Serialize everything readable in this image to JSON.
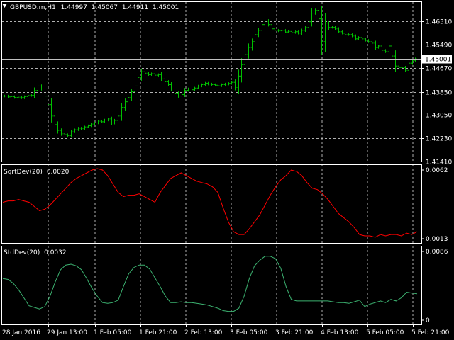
{
  "chart_data": [
    {
      "type": "ohlc",
      "header": {
        "symbol": "GBPUSD.m,H1",
        "open": "1.44997",
        "high": "1.45067",
        "low": "1.44911",
        "close": "1.45001"
      },
      "ylim": [
        1.4141,
        1.4701
      ],
      "y_ticks": [
        "1.46310",
        "1.45490",
        "1.44670",
        "1.43850",
        "1.43050",
        "1.42230",
        "1.41410"
      ],
      "current_price": "1.45001",
      "colors": {
        "bars": "#00c000",
        "price_line": "#c0c0c0",
        "current_label_bg": "#ffffff"
      },
      "closes": [
        1.437,
        1.4367,
        1.4368,
        1.4365,
        1.4366,
        1.4364,
        1.4368,
        1.4372,
        1.4372,
        1.439,
        1.4405,
        1.4395,
        1.437,
        1.434,
        1.43,
        1.427,
        1.425,
        1.4238,
        1.4235,
        1.4232,
        1.4245,
        1.4252,
        1.4258,
        1.4256,
        1.4262,
        1.4266,
        1.4272,
        1.4276,
        1.4282,
        1.428,
        1.4286,
        1.429,
        1.4276,
        1.4285,
        1.43,
        1.433,
        1.435,
        1.4365,
        1.4385,
        1.4405,
        1.4435,
        1.4455,
        1.445,
        1.4445,
        1.4448,
        1.4443,
        1.4445,
        1.443,
        1.442,
        1.441,
        1.4395,
        1.438,
        1.437,
        1.4375,
        1.439,
        1.4395,
        1.4392,
        1.4398,
        1.4405,
        1.441,
        1.4415,
        1.4412,
        1.441,
        1.4408,
        1.4406,
        1.441,
        1.4412,
        1.4414,
        1.4418,
        1.44,
        1.444,
        1.448,
        1.4515,
        1.454,
        1.456,
        1.4585,
        1.46,
        1.462,
        1.4632,
        1.462,
        1.4605,
        1.46,
        1.4598,
        1.46,
        1.4594,
        1.4596,
        1.4592,
        1.4595,
        1.459,
        1.46,
        1.461,
        1.463,
        1.466,
        1.467,
        1.464,
        1.456,
        1.4625,
        1.461,
        1.461,
        1.4605,
        1.4595,
        1.459,
        1.4585,
        1.4585,
        1.458,
        1.457,
        1.4575,
        1.457,
        1.4565,
        1.456,
        1.4555,
        1.454,
        1.4545,
        1.453,
        1.4525,
        1.4545,
        1.451,
        1.4475,
        1.447,
        1.447,
        1.446,
        1.4485,
        1.4495,
        1.45
      ]
    },
    {
      "type": "line",
      "header": {
        "name": "SqrtDev(20)",
        "value": "0.0020"
      },
      "ylim": [
        0.0013,
        0.0062
      ],
      "y_ticks": [
        "0.0062",
        "0.0013"
      ],
      "colors": {
        "line": "#ff0000"
      },
      "values": [
        0.0039,
        0.004,
        0.004,
        0.0041,
        0.004,
        0.0039,
        0.0036,
        0.0033,
        0.0034,
        0.0037,
        0.0041,
        0.0045,
        0.0049,
        0.0053,
        0.0056,
        0.0058,
        0.006,
        0.0062,
        0.0063,
        0.0062,
        0.0058,
        0.0052,
        0.0046,
        0.0043,
        0.0044,
        0.0044,
        0.0045,
        0.0043,
        0.0041,
        0.0039,
        0.0046,
        0.0051,
        0.0056,
        0.0058,
        0.006,
        0.0058,
        0.0056,
        0.0054,
        0.0053,
        0.0052,
        0.005,
        0.0046,
        0.0035,
        0.0025,
        0.0018,
        0.0016,
        0.0016,
        0.002,
        0.0025,
        0.003,
        0.0037,
        0.0044,
        0.005,
        0.0055,
        0.0058,
        0.0062,
        0.0061,
        0.0058,
        0.0053,
        0.0049,
        0.0048,
        0.0045,
        0.0041,
        0.0036,
        0.0031,
        0.0028,
        0.0025,
        0.0021,
        0.0016,
        0.0015,
        0.0015,
        0.0014,
        0.0016,
        0.0015,
        0.0016,
        0.0016,
        0.0015,
        0.0017,
        0.0016,
        0.0018
      ]
    },
    {
      "type": "line",
      "header": {
        "name": "StdDev(20)",
        "value": "0.0032"
      },
      "ylim": [
        0,
        0.0086
      ],
      "y_ticks": [
        "0.0086",
        "0"
      ],
      "colors": {
        "line": "#3cb371"
      },
      "values": [
        0.0052,
        0.0051,
        0.0046,
        0.0038,
        0.0028,
        0.0018,
        0.0016,
        0.0014,
        0.0017,
        0.003,
        0.0048,
        0.0063,
        0.0069,
        0.007,
        0.0068,
        0.0063,
        0.0052,
        0.004,
        0.003,
        0.0022,
        0.0021,
        0.0022,
        0.0025,
        0.0042,
        0.0058,
        0.0066,
        0.0069,
        0.0069,
        0.0064,
        0.0053,
        0.0042,
        0.003,
        0.0022,
        0.0022,
        0.0023,
        0.0022,
        0.0022,
        0.0021,
        0.002,
        0.0019,
        0.0017,
        0.0015,
        0.0012,
        0.0011,
        0.0011,
        0.0015,
        0.003,
        0.0052,
        0.0068,
        0.0075,
        0.008,
        0.008,
        0.0077,
        0.0065,
        0.0042,
        0.0026,
        0.0024,
        0.0024,
        0.0024,
        0.0024,
        0.0024,
        0.0024,
        0.0024,
        0.0023,
        0.0022,
        0.0022,
        0.0021,
        0.0023,
        0.0025,
        0.0017,
        0.002,
        0.0022,
        0.0024,
        0.0022,
        0.0026,
        0.0024,
        0.0028,
        0.0035,
        0.0034,
        0.0033
      ]
    }
  ],
  "x_ticks": [
    "28 Jan 2016",
    "29 Jan 13:00",
    "1 Feb 05:00",
    "1 Feb 21:00",
    "2 Feb 13:00",
    "3 Feb 05:00",
    "3 Feb 21:00",
    "4 Feb 13:00",
    "5 Feb 05:00",
    "5 Feb 21:00"
  ],
  "colors": {
    "background": "#000000",
    "grid": "#b0b0b0",
    "text": "#ffffff",
    "frame": "#ffffff"
  }
}
